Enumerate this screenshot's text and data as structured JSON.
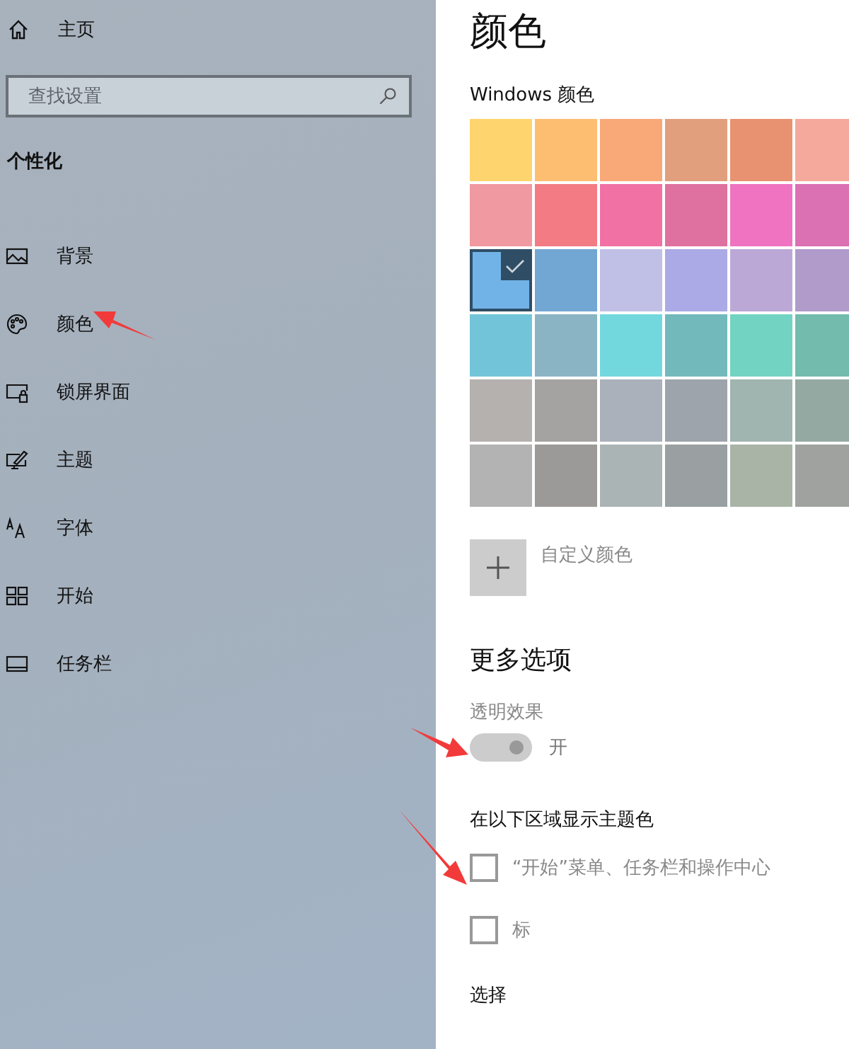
{
  "sidebar": {
    "home": "主页",
    "search": {
      "placeholder": "查找设置"
    },
    "section": "个性化",
    "items": [
      {
        "label": "背景",
        "kind": "picture"
      },
      {
        "label": "颜色",
        "kind": "palette"
      },
      {
        "label": "锁屏界面",
        "kind": "lock"
      },
      {
        "label": "主题",
        "kind": "theme"
      },
      {
        "label": "字体",
        "kind": "font"
      },
      {
        "label": "开始",
        "kind": "start"
      },
      {
        "label": "任务栏",
        "kind": "taskbar"
      }
    ]
  },
  "main": {
    "title": "颜色",
    "palette_label": "Windows 颜色",
    "swatches": [
      {
        "color": "#fed46f",
        "selected": false
      },
      {
        "color": "#fdbe72",
        "selected": false
      },
      {
        "color": "#f9a878",
        "selected": false
      },
      {
        "color": "#e19f7d",
        "selected": false
      },
      {
        "color": "#e99271",
        "selected": false
      },
      {
        "color": "#f5a99c",
        "selected": false
      },
      {
        "color": "#f199a0",
        "selected": false
      },
      {
        "color": "#f27b84",
        "selected": false
      },
      {
        "color": "#f171a4",
        "selected": false
      },
      {
        "color": "#de719f",
        "selected": false
      },
      {
        "color": "#ef73c0",
        "selected": false
      },
      {
        "color": "#db70b3",
        "selected": false
      },
      {
        "color": "#71b3e7",
        "selected": true
      },
      {
        "color": "#72a7d4",
        "selected": false
      },
      {
        "color": "#c0c0e6",
        "selected": false
      },
      {
        "color": "#abaae6",
        "selected": false
      },
      {
        "color": "#bca8d6",
        "selected": false
      },
      {
        "color": "#b09bcb",
        "selected": false
      },
      {
        "color": "#72c5d9",
        "selected": false
      },
      {
        "color": "#8ab4c4",
        "selected": false
      },
      {
        "color": "#72d8dd",
        "selected": false
      },
      {
        "color": "#72b9bc",
        "selected": false
      },
      {
        "color": "#73d3c3",
        "selected": false
      },
      {
        "color": "#72bbad",
        "selected": false
      },
      {
        "color": "#b5b1af",
        "selected": false
      },
      {
        "color": "#a5a3a1",
        "selected": false
      },
      {
        "color": "#aab1bb",
        "selected": false
      },
      {
        "color": "#9da4ab",
        "selected": false
      },
      {
        "color": "#a1b5b0",
        "selected": false
      },
      {
        "color": "#95a9a3",
        "selected": false
      },
      {
        "color": "#b3b3b3",
        "selected": false
      },
      {
        "color": "#9b9a98",
        "selected": false
      },
      {
        "color": "#abb4b5",
        "selected": false
      },
      {
        "color": "#9a9fa2",
        "selected": false
      },
      {
        "color": "#a9b4a7",
        "selected": false
      },
      {
        "color": "#9fa29f",
        "selected": false
      }
    ],
    "custom_color": "自定义颜色",
    "more_heading": "更多选项",
    "transparency": {
      "label": "透明效果",
      "on": true,
      "state_text": "开"
    },
    "accent_heading": "在以下区域显示主题色",
    "checkboxes": [
      {
        "label": "“开始”菜单、任务栏和操作中心",
        "checked": false
      },
      {
        "label": "标",
        "checked": false
      }
    ],
    "bottom_heading": "选择"
  }
}
